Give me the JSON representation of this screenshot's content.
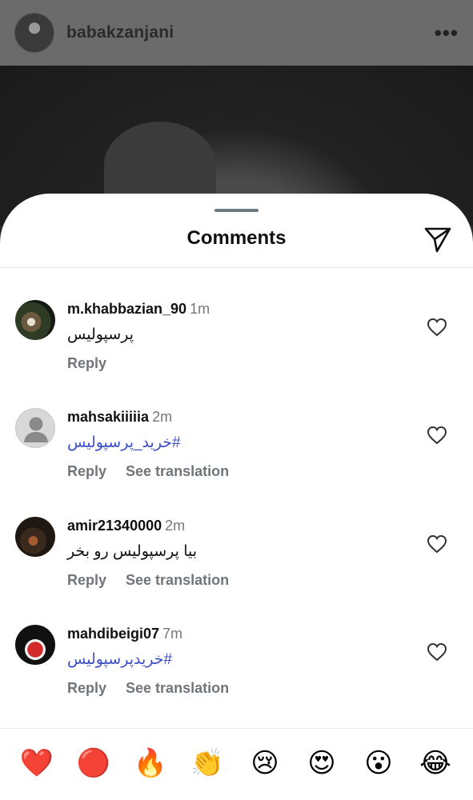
{
  "post": {
    "username": "babakzanjani",
    "more_icon": "more-horizontal-icon"
  },
  "sheet": {
    "title": "Comments",
    "share_icon": "paper-plane-icon"
  },
  "comments": [
    {
      "username": "m.khabbazian_90",
      "time": "1m",
      "text": "پرسپولیس",
      "reply_label": "Reply",
      "translation_label": ""
    },
    {
      "username": "mahsakiiiiia",
      "time": "2m",
      "text": "#خرید_پرسپولیس",
      "reply_label": "Reply",
      "translation_label": "See translation"
    },
    {
      "username": "amir21340000",
      "time": "2m",
      "text": "بیا پرسپولیس رو بخر",
      "reply_label": "Reply",
      "translation_label": "See translation"
    },
    {
      "username": "mahdibeigi07",
      "time": "7m",
      "text": "#خریدپرسپولیس",
      "reply_label": "Reply",
      "translation_label": "See translation"
    }
  ],
  "emoji_reactions": [
    "❤️",
    "🔴",
    "🔥",
    "👏",
    "😢",
    "😍",
    "😮",
    "😂"
  ],
  "colors": {
    "hashtag": "#3c4ec7",
    "secondary_text": "#70757a"
  }
}
